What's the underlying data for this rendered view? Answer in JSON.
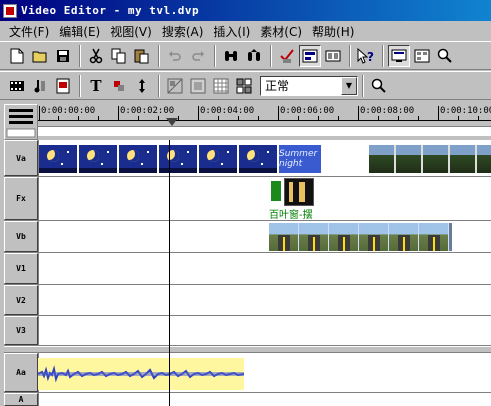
{
  "window": {
    "title": "Video Editor - my tvl.dvp"
  },
  "menu": [
    "文件(F)",
    "编辑(E)",
    "视图(V)",
    "搜索(A)",
    "插入(I)",
    "素材(C)",
    "帮助(H)"
  ],
  "toolbar2": {
    "transition_mode": "正常"
  },
  "ruler": {
    "labels": [
      "0:00:00:00",
      "0:00:02:00",
      "0:00:04:00",
      "0:00:06:00",
      "0:00:08:00",
      "0:00:10:00"
    ]
  },
  "tracks": [
    {
      "label": "Va"
    },
    {
      "label": "Fx"
    },
    {
      "label": "Vb"
    },
    {
      "label": "V1"
    },
    {
      "label": "V2"
    },
    {
      "label": "V3"
    },
    {
      "label": "Aa"
    },
    {
      "label": "A"
    }
  ],
  "clips": {
    "title_clip_text": "Summer night",
    "fx_label": "百叶窗-摆"
  },
  "colors": {
    "title_bar_start": "#000080",
    "title_bar_end": "#1084d0",
    "audio_clip": "#fff6a0",
    "audio_wave": "#3040c0",
    "fx_label": "#008000"
  }
}
